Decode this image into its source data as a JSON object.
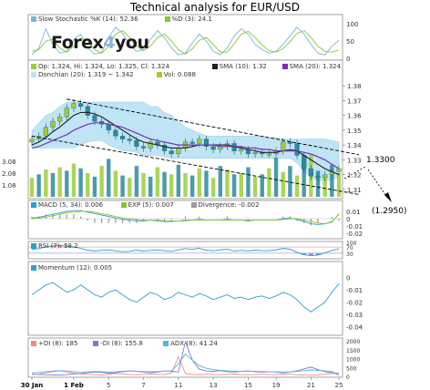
{
  "title": "Technical analysis for EUR/USD",
  "logo": {
    "pre": "Forex",
    "mid": "4",
    "post": "you"
  },
  "colors": {
    "price_up": "#9dcc3a",
    "price_down": "#2a8a9e",
    "sma_fast": "#222222",
    "sma_slow": "#7a2fb5",
    "donchian_fill": "#bfe4f6",
    "trend": "#000000",
    "k": "#74b8d6",
    "d": "#8ec22e",
    "rsi_up": "#f09595",
    "rsi_down": "#8a9ed8",
    "plus_di": "#f08a8a",
    "minus_di": "#7a7ad6",
    "adx": "#58b6d8"
  },
  "annotations": {
    "target_1": "1.3300",
    "target_2": "(1.2950)"
  },
  "chart_data": [
    {
      "type": "line",
      "name": "stochastic",
      "legend": [
        "Slow Stochastic %K (14): 52.36",
        "%D (3): 24.1"
      ],
      "ylim": [
        0,
        100
      ],
      "ytick_labels": [
        "0",
        "50",
        "100"
      ],
      "series": [
        {
          "name": "%K",
          "values": [
            10,
            30,
            85,
            40,
            15,
            20,
            55,
            70,
            30,
            12,
            18,
            60,
            90,
            72,
            40,
            20,
            25,
            55,
            80,
            60,
            30,
            10,
            15,
            45,
            70,
            50,
            20,
            10,
            30,
            65,
            85,
            70,
            40,
            25,
            15,
            20,
            40,
            65,
            90,
            70,
            40,
            15,
            10,
            35,
            52
          ]
        },
        {
          "name": "%D",
          "values": [
            20,
            25,
            50,
            55,
            30,
            18,
            35,
            58,
            50,
            25,
            15,
            35,
            70,
            80,
            60,
            35,
            22,
            35,
            60,
            70,
            50,
            25,
            12,
            28,
            52,
            60,
            40,
            18,
            18,
            42,
            70,
            78,
            60,
            38,
            22,
            18,
            28,
            48,
            72,
            80,
            60,
            35,
            20,
            18,
            24
          ]
        }
      ]
    },
    {
      "type": "candlestick",
      "name": "price",
      "legend": [
        "Op: 1.324, Hi: 1.324, Lo: 1.325, Cl: 1.324",
        "SMA (10): 1.32",
        "SMA (20): 1.324",
        "Donchian (20): 1.319 ~ 1.342",
        "Vol: 0.088"
      ],
      "ylim": [
        1.305,
        1.385
      ],
      "ytick_labels": [
        "1.31",
        "1.32",
        "1.33",
        "1.34",
        "1.35",
        "1.36",
        "1.37",
        "1.38"
      ],
      "volume_tick_labels": [
        "1.08",
        "2.08",
        "3.08"
      ],
      "x_tick_labels": [
        "30 Jan",
        "1 Feb",
        "5",
        "7",
        "11",
        "13",
        "15",
        "19",
        "21",
        "25"
      ],
      "close": [
        1.344,
        1.346,
        1.352,
        1.356,
        1.359,
        1.365,
        1.368,
        1.366,
        1.36,
        1.356,
        1.354,
        1.35,
        1.346,
        1.344,
        1.343,
        1.339,
        1.338,
        1.342,
        1.34,
        1.336,
        1.334,
        1.338,
        1.342,
        1.341,
        1.344,
        1.339,
        1.337,
        1.339,
        1.341,
        1.336,
        1.337,
        1.334,
        1.335,
        1.334,
        1.334,
        1.336,
        1.342,
        1.341,
        1.333,
        1.324,
        1.319,
        1.318,
        1.32,
        1.322,
        1.324
      ],
      "sma10": [
        1.34,
        1.342,
        1.345,
        1.349,
        1.352,
        1.356,
        1.36,
        1.362,
        1.362,
        1.361,
        1.359,
        1.356,
        1.353,
        1.35,
        1.347,
        1.344,
        1.342,
        1.341,
        1.34,
        1.339,
        1.338,
        1.338,
        1.338,
        1.339,
        1.34,
        1.34,
        1.34,
        1.34,
        1.34,
        1.339,
        1.338,
        1.337,
        1.336,
        1.335,
        1.335,
        1.335,
        1.336,
        1.337,
        1.336,
        1.333,
        1.33,
        1.327,
        1.324,
        1.322,
        1.32
      ],
      "sma20": [
        1.338,
        1.339,
        1.341,
        1.343,
        1.345,
        1.347,
        1.35,
        1.352,
        1.354,
        1.355,
        1.355,
        1.354,
        1.353,
        1.352,
        1.35,
        1.348,
        1.346,
        1.344,
        1.343,
        1.342,
        1.341,
        1.34,
        1.34,
        1.34,
        1.34,
        1.34,
        1.34,
        1.339,
        1.339,
        1.339,
        1.339,
        1.338,
        1.338,
        1.337,
        1.337,
        1.336,
        1.336,
        1.336,
        1.336,
        1.335,
        1.334,
        1.332,
        1.33,
        1.327,
        1.324
      ],
      "donchian_upper": [
        1.35,
        1.355,
        1.36,
        1.362,
        1.366,
        1.369,
        1.369,
        1.369,
        1.369,
        1.369,
        1.369,
        1.369,
        1.369,
        1.369,
        1.369,
        1.369,
        1.369,
        1.366,
        1.366,
        1.362,
        1.36,
        1.356,
        1.352,
        1.35,
        1.348,
        1.346,
        1.346,
        1.346,
        1.346,
        1.346,
        1.346,
        1.346,
        1.346,
        1.346,
        1.345,
        1.345,
        1.344,
        1.344,
        1.344,
        1.344,
        1.344,
        1.344,
        1.344,
        1.343,
        1.342
      ],
      "donchian_lower": [
        1.338,
        1.338,
        1.338,
        1.338,
        1.338,
        1.338,
        1.338,
        1.34,
        1.342,
        1.343,
        1.343,
        1.34,
        1.338,
        1.336,
        1.336,
        1.335,
        1.333,
        1.333,
        1.333,
        1.332,
        1.331,
        1.331,
        1.331,
        1.331,
        1.331,
        1.331,
        1.331,
        1.331,
        1.331,
        1.331,
        1.331,
        1.331,
        1.331,
        1.331,
        1.331,
        1.331,
        1.331,
        1.331,
        1.328,
        1.322,
        1.318,
        1.316,
        1.316,
        1.316,
        1.319
      ],
      "volume": [
        1.6,
        1.9,
        2.3,
        2.0,
        2.5,
        2.2,
        2.8,
        2.4,
        2.0,
        1.7,
        2.6,
        3.2,
        2.2,
        1.8,
        1.6,
        2.6,
        2.0,
        1.7,
        2.5,
        2.1,
        1.9,
        2.7,
        2.0,
        1.8,
        2.4,
        2.2,
        1.6,
        2.6,
        2.3,
        1.9,
        2.0,
        2.5,
        1.7,
        1.9,
        2.4,
        3.3,
        2.1,
        2.6,
        1.8,
        2.9,
        3.6,
        2.2,
        1.8,
        2.7,
        2.0
      ],
      "trend_upper": [
        [
          5,
          1.371
        ],
        [
          44,
          1.336
        ]
      ],
      "trend_lower": [
        [
          0,
          1.346
        ],
        [
          44,
          1.309
        ]
      ]
    },
    {
      "type": "line",
      "name": "macd",
      "legend": [
        "MACD (5, 34): 0.006",
        "EXP (5): 0.007",
        "Divergence: -0.002"
      ],
      "ylim": [
        -0.025,
        0.015
      ],
      "ytick_labels": [
        "-0.02",
        "-0.01",
        "0",
        "0.01"
      ],
      "series": [
        {
          "name": "MACD",
          "values": [
            0.001,
            0.002,
            0.004,
            0.006,
            0.008,
            0.01,
            0.011,
            0.011,
            0.009,
            0.007,
            0.005,
            0.003,
            0.001,
            -0.001,
            -0.002,
            -0.003,
            -0.003,
            -0.002,
            -0.003,
            -0.004,
            -0.004,
            -0.003,
            -0.002,
            -0.002,
            -0.001,
            -0.002,
            -0.002,
            -0.002,
            -0.001,
            -0.002,
            -0.002,
            -0.003,
            -0.002,
            -0.002,
            -0.002,
            -0.002,
            0.0,
            0.001,
            -0.001,
            -0.004,
            -0.007,
            -0.008,
            -0.007,
            -0.004,
            0.006
          ]
        },
        {
          "name": "EXP",
          "values": [
            0.0,
            0.001,
            0.002,
            0.004,
            0.006,
            0.008,
            0.009,
            0.01,
            0.01,
            0.009,
            0.007,
            0.005,
            0.003,
            0.001,
            0.0,
            -0.001,
            -0.002,
            -0.002,
            -0.002,
            -0.003,
            -0.003,
            -0.003,
            -0.003,
            -0.002,
            -0.002,
            -0.002,
            -0.002,
            -0.002,
            -0.002,
            -0.002,
            -0.002,
            -0.002,
            -0.002,
            -0.002,
            -0.002,
            -0.002,
            -0.001,
            0.0,
            0.0,
            -0.002,
            -0.004,
            -0.006,
            -0.007,
            -0.005,
            0.007
          ]
        }
      ]
    },
    {
      "type": "line",
      "name": "rsi",
      "legend": [
        "RSI (7): 58.2"
      ],
      "ylim": [
        0,
        100
      ],
      "ytick_labels": [
        "30",
        "70",
        "100"
      ],
      "bands": [
        30,
        70
      ],
      "values": [
        55,
        60,
        72,
        78,
        80,
        76,
        72,
        62,
        50,
        44,
        48,
        52,
        45,
        40,
        42,
        50,
        44,
        48,
        52,
        46,
        42,
        52,
        60,
        55,
        62,
        50,
        46,
        52,
        56,
        44,
        48,
        45,
        50,
        46,
        46,
        52,
        62,
        56,
        36,
        20,
        14,
        18,
        32,
        48,
        58
      ]
    },
    {
      "type": "line",
      "name": "momentum",
      "legend": [
        "Momentum (12): 0.005"
      ],
      "ylim": [
        -0.045,
        0.005
      ],
      "ytick_labels": [
        "-0.04",
        "-0.03",
        "-0.02",
        "-0.01",
        "0"
      ],
      "values": [
        -0.014,
        -0.01,
        -0.006,
        -0.004,
        -0.008,
        -0.012,
        -0.01,
        -0.006,
        -0.01,
        -0.014,
        -0.016,
        -0.012,
        -0.01,
        -0.014,
        -0.018,
        -0.02,
        -0.016,
        -0.012,
        -0.014,
        -0.018,
        -0.016,
        -0.012,
        -0.014,
        -0.016,
        -0.013,
        -0.015,
        -0.018,
        -0.016,
        -0.014,
        -0.017,
        -0.016,
        -0.018,
        -0.016,
        -0.015,
        -0.017,
        -0.015,
        -0.012,
        -0.014,
        -0.018,
        -0.024,
        -0.028,
        -0.024,
        -0.02,
        -0.012,
        -0.005
      ]
    },
    {
      "type": "line",
      "name": "dmi",
      "legend": [
        "+DI (8): 185",
        "-DI (8): 155.8",
        "ADX (8): 41.24"
      ],
      "ylim": [
        0,
        2000
      ],
      "ytick_labels": [
        "0",
        "500",
        "1000",
        "1500",
        "2000"
      ],
      "series": [
        {
          "name": "+DI",
          "values": [
            90,
            120,
            200,
            260,
            320,
            240,
            180,
            140,
            110,
            90,
            80,
            120,
            160,
            140,
            100,
            90,
            110,
            140,
            120,
            100,
            180,
            1100,
            160,
            110,
            90,
            120,
            100,
            90,
            110,
            130,
            100,
            90,
            100,
            120,
            100,
            110,
            130,
            120,
            90,
            70,
            60,
            80,
            120,
            160,
            185
          ]
        },
        {
          "name": "-DI",
          "values": [
            120,
            110,
            90,
            80,
            70,
            100,
            140,
            160,
            200,
            240,
            220,
            180,
            200,
            260,
            300,
            280,
            240,
            200,
            240,
            300,
            280,
            240,
            1950,
            900,
            400,
            300,
            280,
            320,
            260,
            240,
            280,
            300,
            260,
            240,
            260,
            240,
            200,
            240,
            320,
            420,
            520,
            380,
            260,
            200,
            156
          ]
        },
        {
          "name": "ADX",
          "values": [
            200,
            220,
            260,
            300,
            320,
            300,
            260,
            240,
            250,
            270,
            260,
            240,
            250,
            280,
            300,
            290,
            270,
            260,
            270,
            290,
            300,
            700,
            1250,
            900,
            600,
            450,
            380,
            340,
            310,
            290,
            280,
            290,
            280,
            270,
            260,
            250,
            240,
            250,
            280,
            320,
            360,
            340,
            300,
            280,
            41
          ]
        }
      ]
    }
  ]
}
